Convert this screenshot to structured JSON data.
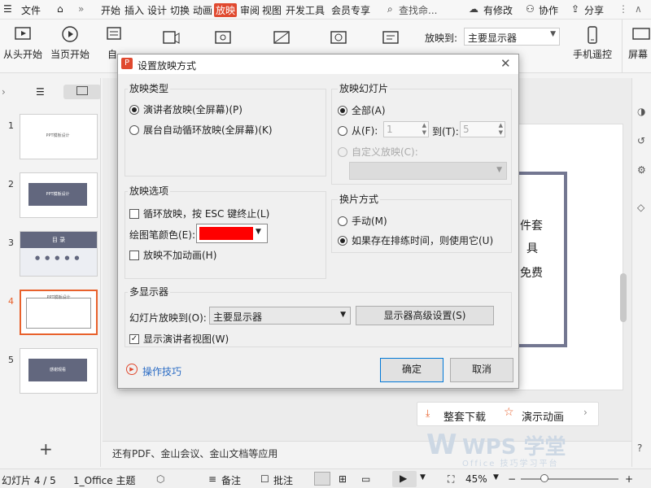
{
  "menubar": {
    "file": "文件",
    "tabs": [
      "开始",
      "插入",
      "设计",
      "切换",
      "动画",
      "放映",
      "审阅",
      "视图",
      "开发工具",
      "会员专享"
    ],
    "active_tab": "放映",
    "search": "查找命...",
    "has_changes": "有修改",
    "collab": "协作",
    "share": "分享"
  },
  "ribbon": {
    "from_start": "从头开始",
    "from_current": "当页开始",
    "custom": "自",
    "show_on_label": "放映到:",
    "show_on_value": "主要显示器",
    "phone_remote": "手机遥控",
    "screen": "屏幕"
  },
  "slides": [
    {
      "num": "1",
      "title": "PPT模板设计"
    },
    {
      "num": "2",
      "title": "PPT模板设计"
    },
    {
      "num": "3",
      "title": "目 录"
    },
    {
      "num": "4",
      "title": "PPT模板设计"
    },
    {
      "num": "5",
      "title": "感谢观看"
    }
  ],
  "selected_slide": "4",
  "canvas_text": [
    "件套",
    "具",
    "免费"
  ],
  "canvas_buttons": {
    "download": "整套下载",
    "demo": "演示动画"
  },
  "notes_text": "还有PDF、金山会议、金山文档等应用",
  "watermark": {
    "brand": "WPS 学堂",
    "sub": "Office 技巧学习平台"
  },
  "status": {
    "slide_info": "幻灯片 4 / 5",
    "theme": "1_Office 主题",
    "notes": "备注",
    "comments": "批注",
    "zoom": "45%"
  },
  "dialog": {
    "title": "设置放映方式",
    "show_type": {
      "title": "放映类型",
      "opt1": "演讲者放映(全屏幕)(P)",
      "opt2": "展台自动循环放映(全屏幕)(K)",
      "selected": 1
    },
    "slides_group": {
      "title": "放映幻灯片",
      "all": "全部(A)",
      "from": "从(F):",
      "from_value": "1",
      "to": "到(T):",
      "to_value": "5",
      "custom": "自定义放映(C):"
    },
    "options": {
      "title": "放映选项",
      "loop": "循环放映，按 ESC 键终止(L)",
      "pen_color": "绘图笔颜色(E):",
      "pen_color_hex": "#ff0000",
      "no_anim": "放映不加动画(H)"
    },
    "advance": {
      "title": "换片方式",
      "manual": "手动(M)",
      "timing": "如果存在排练时间，则使用它(U)",
      "selected": 2
    },
    "multi": {
      "title": "多显示器",
      "show_on": "幻灯片放映到(O):",
      "monitor": "主要显示器",
      "advanced_btn": "显示器高级设置(S)",
      "presenter_view": "显示演讲者视图(W)"
    },
    "tips": "操作技巧",
    "ok": "确定",
    "cancel": "取消"
  }
}
